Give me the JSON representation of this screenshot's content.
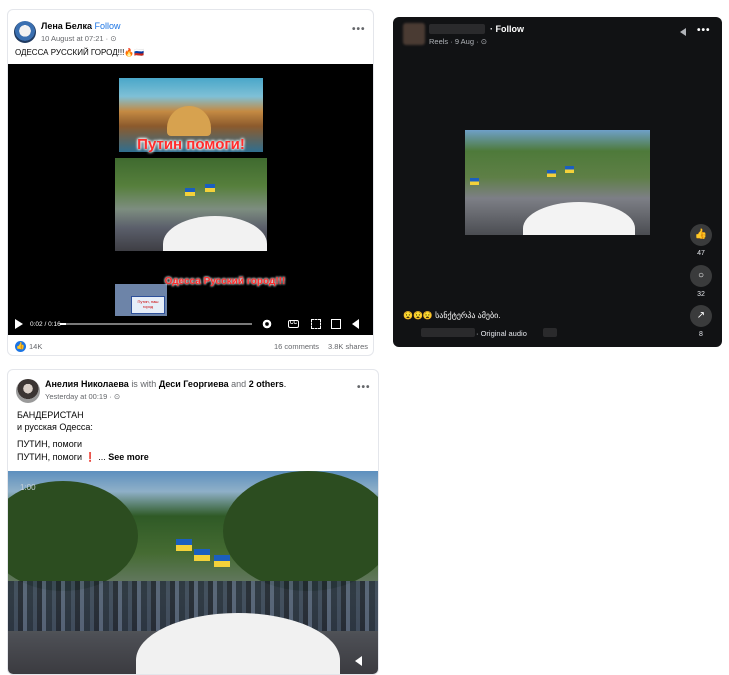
{
  "post1": {
    "author": "Лена Белка",
    "follow": "· Follow",
    "date": "10 August at 07:21 · ⊙",
    "caption": "ОДЕССА РУССКИЙ ГОРОД!!!🔥🇷🇺",
    "video": {
      "overlay_title": "Путин помоги!",
      "overlay_sub": "Одесса Русский город!!!",
      "inset_text": "Путин, наш город",
      "time": "0:02 / 0:16",
      "progress": 0.03,
      "cc_label": "CC"
    },
    "likes": "14K",
    "comments": "16 comments",
    "shares": "3.8K shares"
  },
  "reel": {
    "follow": "· Follow",
    "meta": "Reels · 9 Aug · ⊙",
    "likes": "47",
    "comments": "32",
    "shares": "8",
    "caption": "😧😧😧 სანქტერპა ამები.",
    "audio": "· Original audio"
  },
  "post2": {
    "author": "Анелия Николаева",
    "with_text": "is with",
    "tagged": "Деси Георгиева",
    "and_text": "and",
    "others": "2 others",
    "date": "Yesterday at 00:19 · ⊙",
    "line1": "БАНДЕРИСТАН",
    "line2": "и русская Одесса:",
    "line3": "ПУТИН, помоги",
    "line4": "ПУТИН, помоги ❗ ... ",
    "see_more": "See more",
    "timecode": "1:00"
  },
  "icons": {
    "like": "👍",
    "more": "•••",
    "comment": "○",
    "share": "↗"
  },
  "colors": {
    "facebook_blue": "#1b74e4",
    "reel_bg": "#111214",
    "overlay_red": "#ff2d2d"
  }
}
